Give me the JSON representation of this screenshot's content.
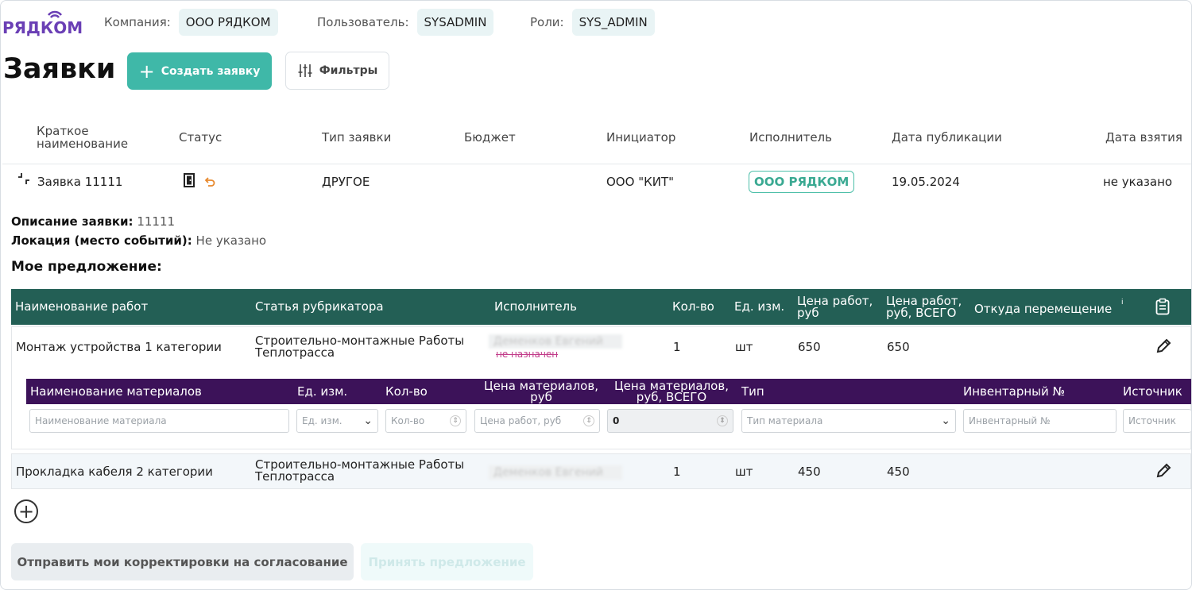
{
  "brand": {
    "name": "РЯДКОМ",
    "color": "#6a3fb5"
  },
  "topbar": {
    "company_label": "Компания:",
    "company_value": "ООО РЯДКОМ",
    "user_label": "Пользователь:",
    "user_value": "SYSADMIN",
    "roles_label": "Роли:",
    "roles_value": "SYS_ADMIN"
  },
  "header": {
    "title": "Заявки",
    "create_label": "Создать заявку",
    "filter_label": "Фильтры"
  },
  "list_columns": [
    "Краткое наименование",
    "Статус",
    "Тип заявки",
    "Бюджет",
    "Инициатор",
    "Исполнитель",
    "Дата публикации",
    "Дата взятия"
  ],
  "request": {
    "name": "Заявка 11111",
    "type": "ДРУГОЕ",
    "budget": "",
    "initiator": "ООО \"КИТ\"",
    "executor": "ООО РЯДКОМ",
    "published": "19.05.2024",
    "taken": "не указано",
    "status_icons": [
      "door-icon",
      "undo-icon"
    ]
  },
  "details": {
    "desc_label": "Описание заявки:",
    "desc_value": "11111",
    "location_label": "Локация (место событий):",
    "location_value": "Не указано",
    "offer_title": "Мое предложение:"
  },
  "works_columns": [
    "Наименование работ",
    "Статья рубрикатора",
    "Исполнитель",
    "Кол-во",
    "Ед. изм.",
    "Цена работ, руб",
    "Цена работ, руб, ВСЕГО",
    "Откуда перемещение"
  ],
  "works": [
    {
      "name": "Монтаж устройства 1 категории",
      "rubric": "Строительно-монтажные Работы Теплотрасса",
      "executor": "Деменков Евгений",
      "executor_status": "не назначен",
      "qty": "1",
      "unit": "шт",
      "price": "650",
      "total": "650"
    },
    {
      "name": "Прокладка кабеля 2 категории",
      "rubric": "Строительно-монтажные Работы Теплотрасса",
      "executor": "Деменков Евгений",
      "executor_status": "",
      "qty": "1",
      "unit": "шт",
      "price": "450",
      "total": "450"
    }
  ],
  "materials_columns": [
    "Наименование материалов",
    "Ед. изм.",
    "Кол-во",
    "Цена материалов, руб",
    "Цена материалов, руб, ВСЕГО",
    "Тип",
    "Инвентарный №",
    "Источник"
  ],
  "materials_inputs": {
    "name_ph": "Наименование материала",
    "unit_ph": "Ед. изм.",
    "qty_ph": "Кол-во",
    "price_ph": "Цена работ, руб",
    "total_value": "0",
    "type_ph": "Тип материала",
    "inventory_ph": "Инвентарный №",
    "source_ph": "Источник"
  },
  "actions": {
    "send_label": "Отправить мои корректировки на согласование",
    "accept_label": "Принять предложение"
  },
  "colors": {
    "accent": "#3fb8a8",
    "works_header": "#235f55",
    "materials_header": "#3c1259"
  }
}
